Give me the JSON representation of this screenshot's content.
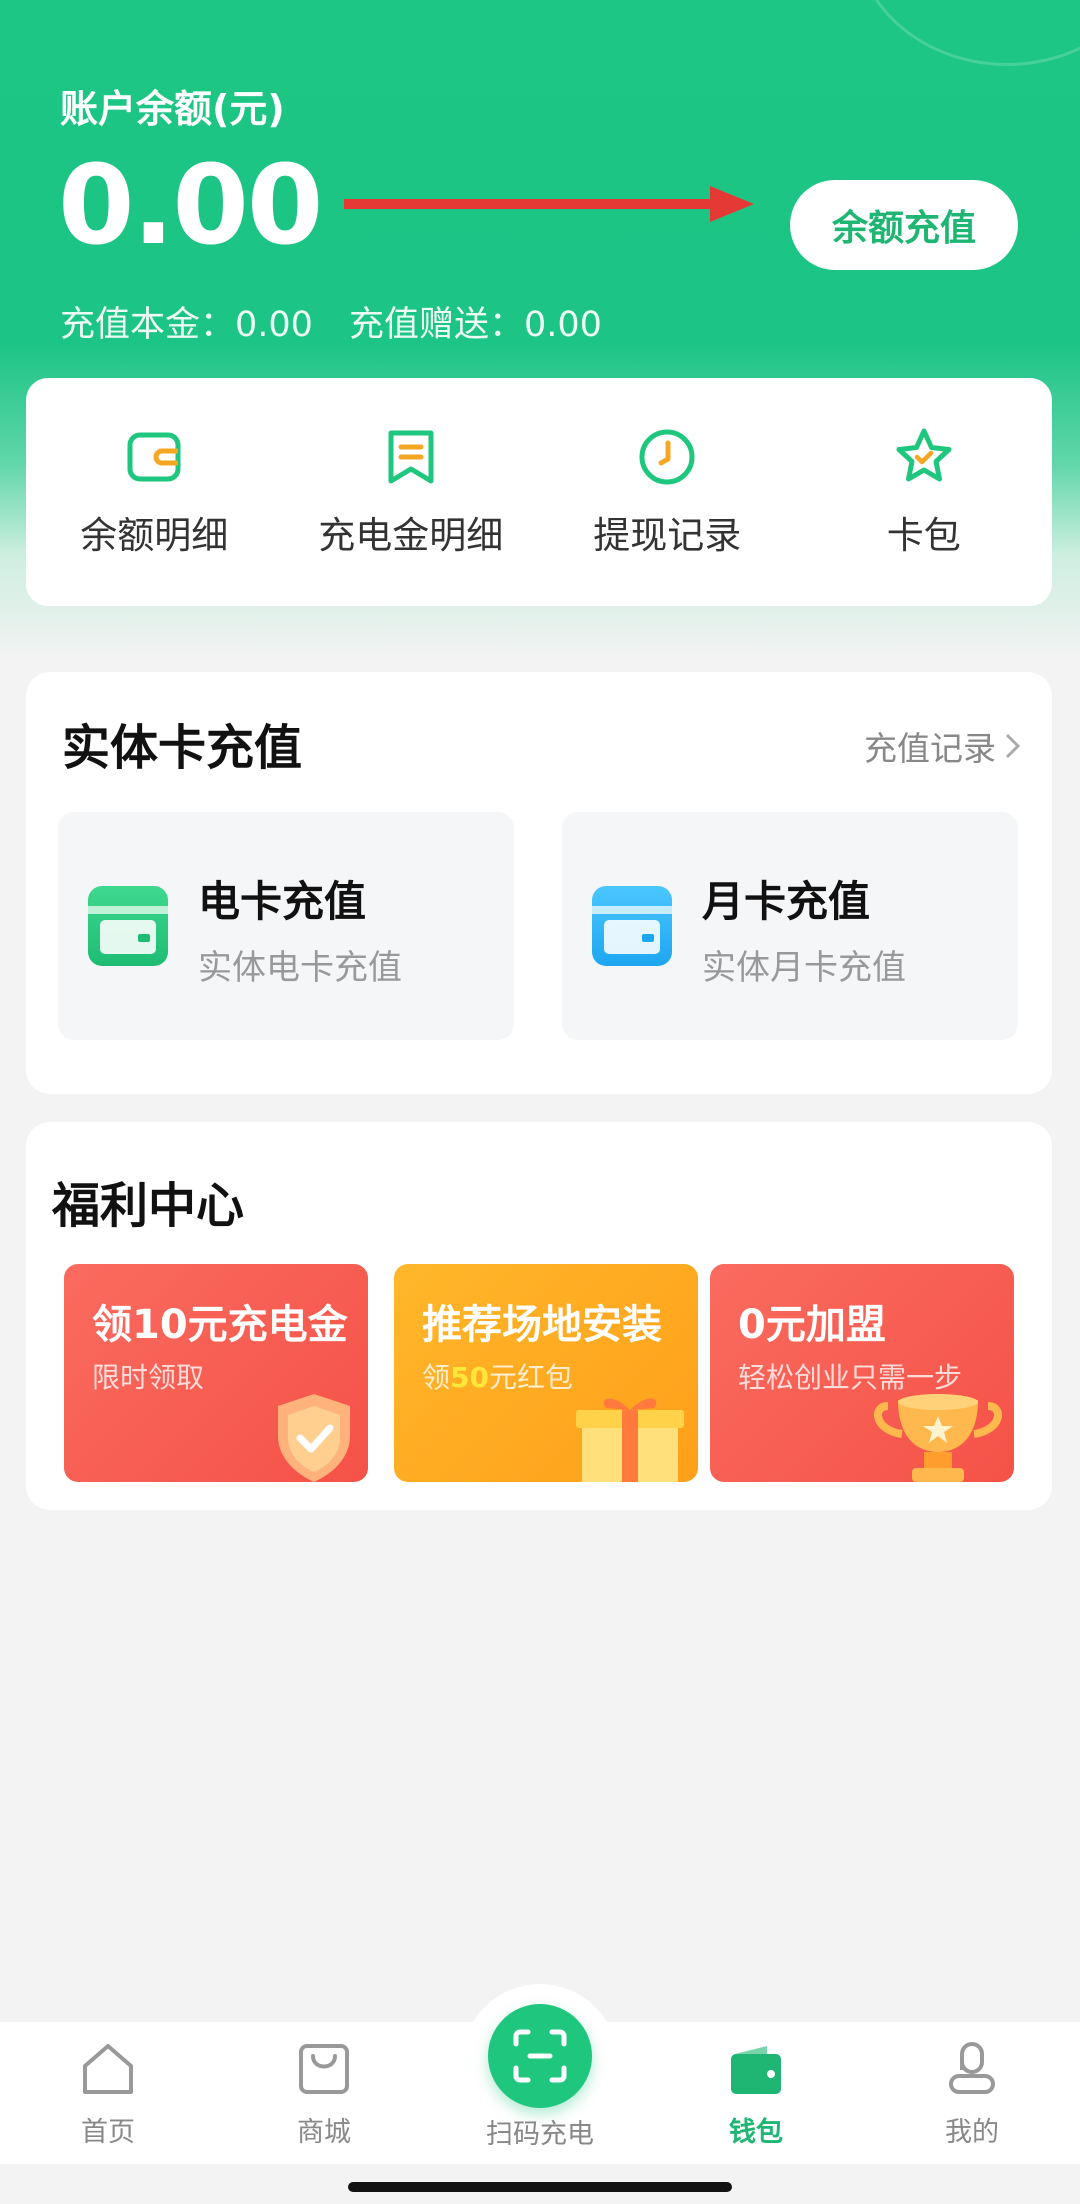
{
  "account": {
    "balance_label": "账户余额(元)",
    "balance": "0.00",
    "recharge_button": "余额充值",
    "principal_label": "充值本金：0.00",
    "bonus_label": "充值赠送：0.00"
  },
  "quick_actions": [
    {
      "label": "余额明细",
      "icon": "wallet-icon"
    },
    {
      "label": "充电金明细",
      "icon": "bookmark-list-icon"
    },
    {
      "label": "提现记录",
      "icon": "clock-icon"
    },
    {
      "label": "卡包",
      "icon": "star-icon"
    }
  ],
  "physical_card": {
    "title": "实体卡充值",
    "record_link": "充值记录",
    "tiles": [
      {
        "title": "电卡充值",
        "subtitle": "实体电卡充值",
        "icon": "green-card-icon"
      },
      {
        "title": "月卡充值",
        "subtitle": "实体月卡充值",
        "icon": "blue-card-icon"
      }
    ]
  },
  "welfare": {
    "title": "福利中心",
    "promos": [
      {
        "title": "领10元充电金",
        "subtitle": "限时领取",
        "icon": "shield-check-icon"
      },
      {
        "title": "推荐场地安装",
        "subtitle_prefix": "领",
        "subtitle_highlight": "50",
        "subtitle_suffix": "元红包",
        "icon": "gift-box-icon"
      },
      {
        "title": "0元加盟",
        "subtitle": "轻松创业只需一步",
        "icon": "trophy-icon"
      }
    ]
  },
  "tabbar": {
    "tabs": [
      {
        "label": "首页",
        "icon": "home-icon"
      },
      {
        "label": "商城",
        "icon": "shopping-bag-icon"
      },
      {
        "label": "扫码充电",
        "icon": "scan-icon"
      },
      {
        "label": "钱包",
        "icon": "wallet-icon",
        "active": true
      },
      {
        "label": "我的",
        "icon": "profile-icon"
      }
    ]
  },
  "colors": {
    "brand_green": "#1ec684",
    "accent_red": "#e53935",
    "promo_red": "#f55247",
    "promo_orange": "#ffa91f"
  }
}
